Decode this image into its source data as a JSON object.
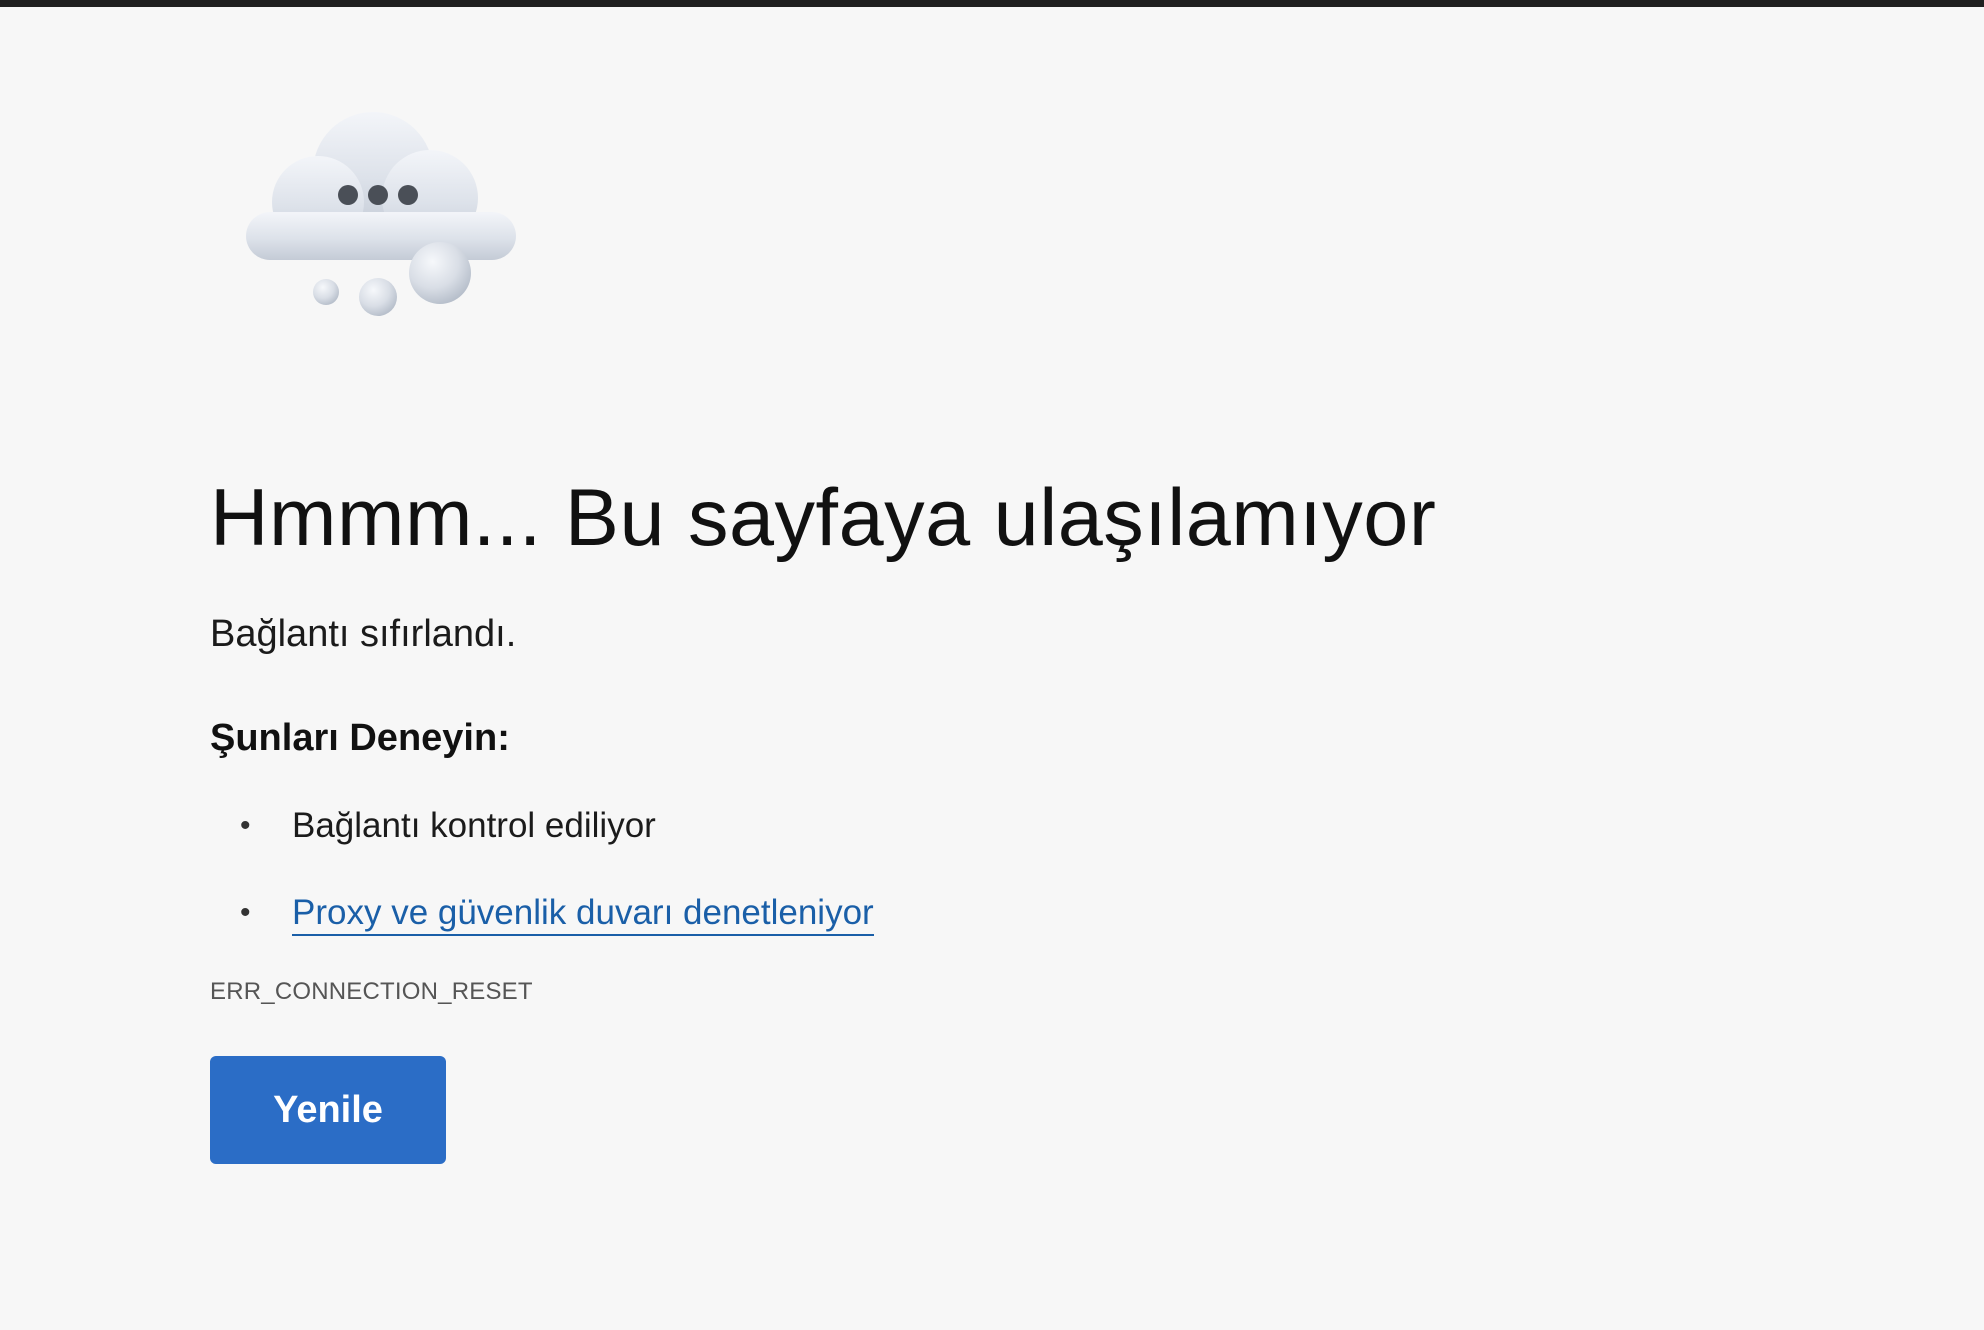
{
  "error_page": {
    "illustration": "cloud-thinking-icon",
    "title": "Hmmm... Bu sayfaya ulaşılamıyor",
    "description": "Bağlantı sıfırlandı.",
    "suggestions_heading": "Şunları Deneyin:",
    "suggestions": [
      {
        "label": "Bağlantı kontrol ediliyor",
        "is_link": false
      },
      {
        "label": "Proxy ve güvenlik duvarı denetleniyor",
        "is_link": true
      }
    ],
    "error_code": "ERR_CONNECTION_RESET",
    "reload_button_label": "Yenile"
  },
  "colors": {
    "background": "#f7f7f7",
    "link": "#1a5fa8",
    "primary_button": "#2b6dc6",
    "top_bar": "#202020"
  }
}
